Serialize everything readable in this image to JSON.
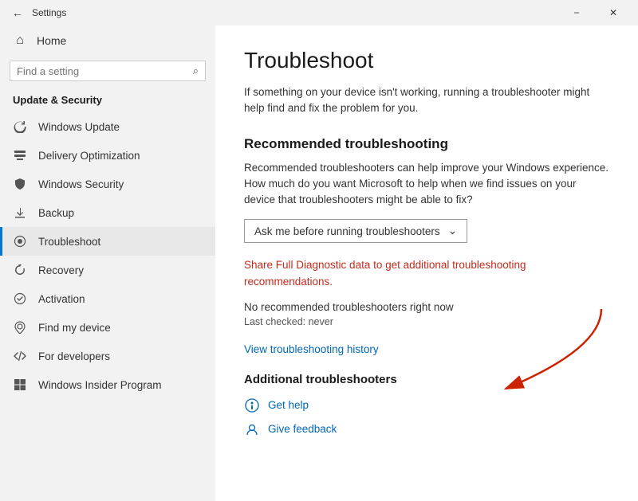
{
  "titlebar": {
    "title": "Settings",
    "minimize_label": "−",
    "close_label": "✕"
  },
  "sidebar": {
    "home_label": "Home",
    "search_placeholder": "Find a setting",
    "section_title": "Update & Security",
    "items": [
      {
        "id": "windows-update",
        "label": "Windows Update",
        "icon": "↻"
      },
      {
        "id": "delivery-optimization",
        "label": "Delivery Optimization",
        "icon": "⬇"
      },
      {
        "id": "windows-security",
        "label": "Windows Security",
        "icon": "🛡"
      },
      {
        "id": "backup",
        "label": "Backup",
        "icon": "↑"
      },
      {
        "id": "troubleshoot",
        "label": "Troubleshoot",
        "icon": "⚙"
      },
      {
        "id": "recovery",
        "label": "Recovery",
        "icon": "↺"
      },
      {
        "id": "activation",
        "label": "Activation",
        "icon": "✓"
      },
      {
        "id": "find-my-device",
        "label": "Find my device",
        "icon": "⊕"
      },
      {
        "id": "for-developers",
        "label": "For developers",
        "icon": "⟨⟩"
      },
      {
        "id": "windows-insider",
        "label": "Windows Insider Program",
        "icon": "🪟"
      }
    ]
  },
  "content": {
    "title": "Troubleshoot",
    "description": "If something on your device isn't working, running a troubleshooter might help find and fix the problem for you.",
    "recommended_heading": "Recommended troubleshooting",
    "recommended_desc": "Recommended troubleshooters can help improve your Windows experience. How much do you want Microsoft to help when we find issues on your device that troubleshooters might be able to fix?",
    "dropdown_value": "Ask me before running troubleshooters",
    "dropdown_arrow": "⌄",
    "link_red": "Share Full Diagnostic data to get additional troubleshooting recommendations.",
    "status_text": "No recommended troubleshooters right now",
    "last_checked": "Last checked: never",
    "view_history_link": "View troubleshooting history",
    "additional_section": "Additional troubleshooters",
    "get_help_label": "Get help",
    "give_feedback_label": "Give feedback"
  }
}
